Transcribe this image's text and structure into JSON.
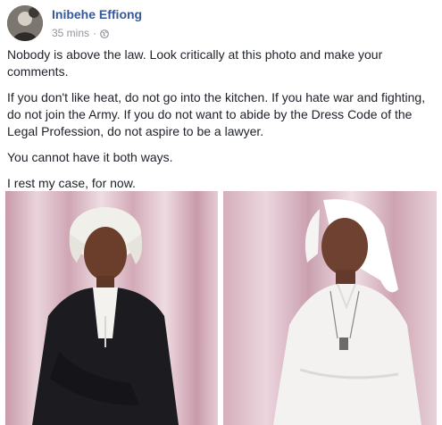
{
  "post": {
    "author": "Inibehe Effiong",
    "timestamp": "35 mins",
    "separator": "·",
    "privacy_icon": "globe-icon",
    "paragraphs": [
      "Nobody is above the law. Look critically at this photo and make your comments.",
      "If you don't like heat, do not go into the kitchen. If you hate war and fighting, do not join the Army. If you do not want to abide by the Dress Code of the Legal Profession, do not aspire to be a lawyer.",
      "You cannot have it both ways.",
      "I rest my case, for now."
    ]
  },
  "photo": {
    "description_icon": "photo",
    "colors": {
      "curtain": "#e3c9d3",
      "robe": "#1c1b1f",
      "habit": "#f4f2f1"
    }
  }
}
